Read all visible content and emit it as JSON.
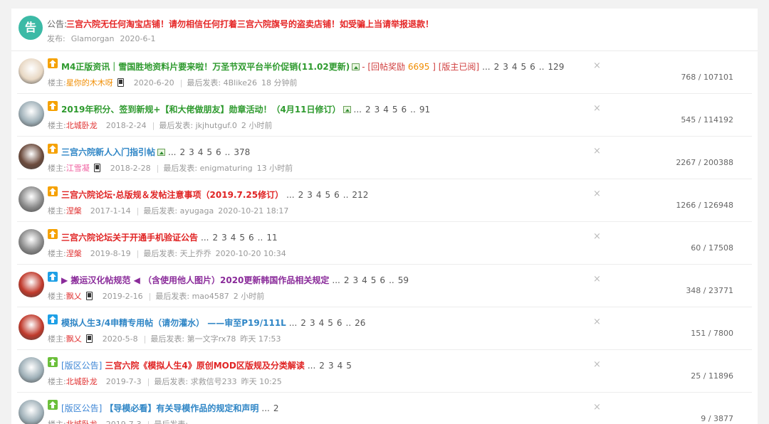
{
  "announcement": {
    "icon_char": "告",
    "label": "公告:",
    "text": "三宫六院无任何淘宝店铺！请勿相信任何打着三宫六院旗号的盗卖店铺！如受骗上当请举报退款！",
    "publish_label": "发布:",
    "publisher": "Glamorgan",
    "date": "2020-6-1"
  },
  "labels": {
    "owner": "楼主:",
    "last_post": "最后发表:",
    "divider": "|",
    "close": "×"
  },
  "threads": [
    {
      "tag": "",
      "title": "M4正版资讯｜雪国胜地资料片要来啦！万圣节双平台半价促销(11.02更新)",
      "title_color": "green",
      "has_image": true,
      "extra": "- [回帖奖励 ",
      "extra_num": "6695",
      "extra_end": " ] [版主已阅]",
      "pages": [
        "...",
        "2",
        "3",
        "4",
        "5",
        "6",
        "..",
        "129"
      ],
      "author": "星你的木木呀",
      "author_color": "orange",
      "mobile": true,
      "date": "2020-6-20",
      "last_poster": "4Blike26",
      "last_time": "18 分钟前",
      "stats": "768 / 107101",
      "avatar_color": "#e8d8c4",
      "level_color": "#f5a100"
    },
    {
      "tag": "",
      "title": "2019年积分、签到新规+【和大佬做朋友】勋章活动！（4月11日修订）",
      "title_color": "green",
      "has_image": true,
      "extra": "",
      "extra_num": "",
      "extra_end": "",
      "pages": [
        "...",
        "2",
        "3",
        "4",
        "5",
        "6",
        "..",
        "91"
      ],
      "author": "北城卧龙",
      "author_color": "red",
      "mobile": false,
      "date": "2018-2-24",
      "last_poster": "jkjhutguf.0",
      "last_time": "2 小时前",
      "stats": "545 / 114192",
      "avatar_color": "#9fb0b8",
      "level_color": "#f5a100"
    },
    {
      "tag": "",
      "title": "三宫六院新人入门指引帖",
      "title_color": "blue",
      "has_image": true,
      "extra": "",
      "extra_num": "",
      "extra_end": "",
      "pages": [
        "...",
        "2",
        "3",
        "4",
        "5",
        "6",
        "..",
        "378"
      ],
      "author": "江雪凝",
      "author_color": "pink",
      "mobile": true,
      "date": "2018-2-28",
      "last_poster": "enigmaturing",
      "last_time": "13 小时前",
      "stats": "2267 / 200388",
      "avatar_color": "#6b4a3c",
      "level_color": "#f5a100"
    },
    {
      "tag": "",
      "title": "三宫六院论坛·总版规＆发帖注意事项（2019.7.25修订）",
      "title_color": "red",
      "has_image": false,
      "extra": "",
      "extra_num": "",
      "extra_end": "",
      "pages": [
        "...",
        "2",
        "3",
        "4",
        "5",
        "6",
        "..",
        "212"
      ],
      "author": "涅槃",
      "author_color": "red",
      "mobile": false,
      "date": "2017-1-14",
      "last_poster": "ayugaga",
      "last_time": "2020-10-21 18:17",
      "stats": "1266 / 126948",
      "avatar_color": "#8a8a8a",
      "level_color": "#f5a100"
    },
    {
      "tag": "",
      "title": "三宫六院论坛关于开通手机验证公告",
      "title_color": "red",
      "has_image": false,
      "extra": "",
      "extra_num": "",
      "extra_end": "",
      "pages": [
        "...",
        "2",
        "3",
        "4",
        "5",
        "6",
        "..",
        "11"
      ],
      "author": "涅槃",
      "author_color": "red",
      "mobile": false,
      "date": "2019-8-19",
      "last_poster": "天上乔乔",
      "last_time": "2020-10-20 10:34",
      "stats": "60 / 17508",
      "avatar_color": "#8a8a8a",
      "level_color": "#f5a100"
    },
    {
      "tag": "",
      "title": "▶ 搬运汉化帖规范 ◀ （含使用他人图片）2020更新韩国作品相关规定",
      "title_color": "purple",
      "has_image": false,
      "extra": "",
      "extra_num": "",
      "extra_end": "",
      "pages": [
        "...",
        "2",
        "3",
        "4",
        "5",
        "6",
        "..",
        "59"
      ],
      "author": "飘乂",
      "author_color": "red",
      "mobile": true,
      "date": "2019-2-16",
      "last_poster": "mao4587",
      "last_time": "2 小时前",
      "stats": "348 / 23771",
      "avatar_color": "#c0392b",
      "level_color": "#1ea0e6"
    },
    {
      "tag": "",
      "title": "模拟人生3/4申精专用帖（请勿灌水） ——审至P19/111L",
      "title_color": "blue",
      "has_image": false,
      "extra": "",
      "extra_num": "",
      "extra_end": "",
      "pages": [
        "...",
        "2",
        "3",
        "4",
        "5",
        "6",
        "..",
        "26"
      ],
      "author": "飘乂",
      "author_color": "red",
      "mobile": true,
      "date": "2020-5-8",
      "last_poster": "第一文字rx78",
      "last_time": "昨天 17:53",
      "stats": "151 / 7800",
      "avatar_color": "#c0392b",
      "level_color": "#1ea0e6"
    },
    {
      "tag": "[版区公告]",
      "title": "三宫六院《模拟人生4》原创MOD区版规及分类解读",
      "title_color": "red",
      "has_image": false,
      "extra": "",
      "extra_num": "",
      "extra_end": "",
      "pages": [
        "...",
        "2",
        "3",
        "4",
        "5"
      ],
      "author": "北城卧龙",
      "author_color": "red",
      "mobile": false,
      "date": "2019-7-3",
      "last_poster": "求救信号233",
      "last_time": "昨天 10:25",
      "stats": "25 / 11896",
      "avatar_color": "#9fb0b8",
      "level_color": "#6bbf3a"
    },
    {
      "tag": "[版区公告]",
      "title": "【导模必看】有关导模作品的规定和声明",
      "title_color": "blue",
      "has_image": false,
      "extra": "",
      "extra_num": "",
      "extra_end": "",
      "pages": [
        "...",
        "2"
      ],
      "author": "北城卧龙",
      "author_color": "red",
      "mobile": false,
      "date": "2019-7-3",
      "last_poster": "",
      "last_time": "",
      "stats": "9 / 3877",
      "avatar_color": "#9fb0b8",
      "level_color": "#6bbf3a"
    }
  ]
}
